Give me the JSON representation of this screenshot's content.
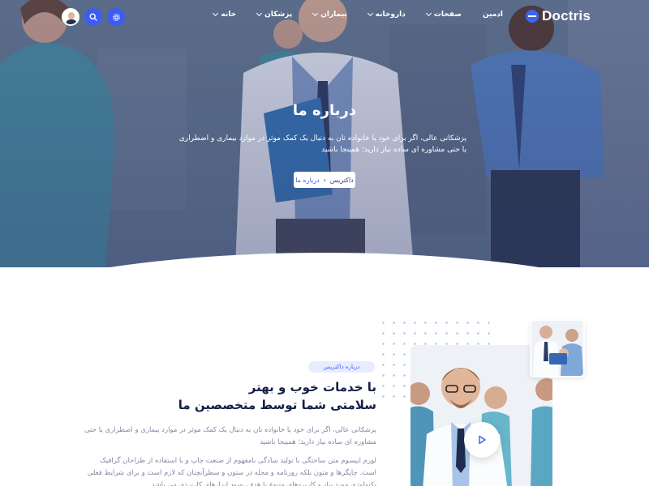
{
  "nav": {
    "logo_text": "Doctris",
    "menu": [
      {
        "label": "خانه",
        "has_dropdown": true
      },
      {
        "label": "پزشکان",
        "has_dropdown": true
      },
      {
        "label": "بیماران",
        "has_dropdown": true
      },
      {
        "label": "داروخانه",
        "has_dropdown": true
      },
      {
        "label": "صفحات",
        "has_dropdown": true
      },
      {
        "label": "ادمین",
        "has_dropdown": false
      }
    ],
    "icons": [
      "avatar",
      "search-icon",
      "gear-icon"
    ]
  },
  "hero": {
    "title": "درباره ما",
    "description": "پزشکانی عالی، اگر برای خود یا خانواده تان به دنبال یک کمک موثر در موارد بیماری و اضطراری یا حتی مشاوره ای ساده نیاز دارید؛ همینجا باشید",
    "breadcrumb": {
      "home": "داکتریس",
      "current": "درباره ما"
    }
  },
  "about": {
    "badge": "درباره داکتریس",
    "title_line1": "با خدمات خوب و بهتر",
    "title_line2": "سلامتی شما توسط متخصصین ما",
    "paragraph1": "پزشکانی عالی، اگر برای خود یا خانواده تان به دنبال یک کمک موثر در موارد بیماری و اضطراری یا حتی مشاوره ای ساده نیاز دارید؛ همینجا باشید",
    "paragraph2": "لورم ایپسوم متن ساختگی با تولید سادگی نامفهوم از صنعت چاپ و با استفاده از طراحان گرافیک است. چاپگرها و متون بلکه روزنامه و مجله در ستون و سطرآنچنان که لازم است و برای شرایط فعلی تکنولوژی مورد نیاز و کاربردهای متنوع با هدف بهبود ابزارهای کاربردی می باشد."
  },
  "colors": {
    "accent": "#3b5df5",
    "heading": "#142047",
    "muted": "#8088a3",
    "badge_bg": "#e8ecff"
  }
}
